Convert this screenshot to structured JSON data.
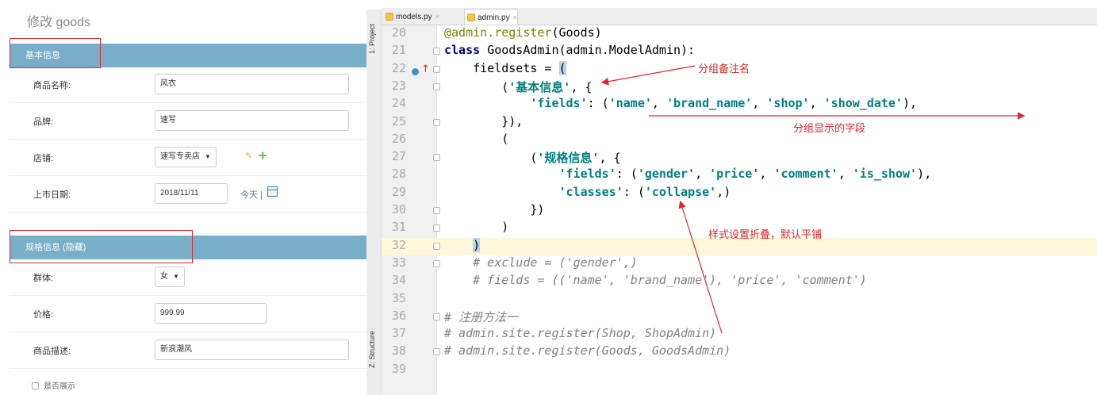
{
  "admin": {
    "page_title": "修改 goods",
    "fieldset1_title": "基本信息",
    "fieldset2_title": "规格信息 (隐藏)",
    "fields": {
      "name": {
        "label": "商品名称:",
        "value": "风衣"
      },
      "brand": {
        "label": "品牌:",
        "value": "速写"
      },
      "shop": {
        "label": "店铺:",
        "value": "速写专卖店"
      },
      "show_date": {
        "label": "上市日期:",
        "value": "2018/11/11",
        "today_label": "今天 |"
      },
      "gender": {
        "label": "群体:",
        "value": "女"
      },
      "price": {
        "label": "价格:",
        "value": "999.99"
      },
      "comment": {
        "label": "商品描述:",
        "value": "新浪潮风"
      },
      "is_show": {
        "label": "是否展示"
      }
    }
  },
  "ide": {
    "tabs": [
      {
        "label": "models.py",
        "active": false
      },
      {
        "label": "admin.py",
        "active": true
      }
    ],
    "side_labels": {
      "project": "1: Project",
      "structure": "Z: Structure"
    },
    "lines": [
      {
        "n": "20",
        "parts": [
          {
            "t": "@admin.register",
            "c": "dec"
          },
          {
            "t": "(Goods)",
            "c": ""
          }
        ]
      },
      {
        "n": "21",
        "parts": [
          {
            "t": "class ",
            "c": "kw"
          },
          {
            "t": "GoodsAdmin(admin.ModelAdmin):",
            "c": ""
          }
        ]
      },
      {
        "n": "22",
        "parts": [
          {
            "t": "    fieldsets = ",
            "c": ""
          },
          {
            "t": "(",
            "c": "bracket-hl"
          }
        ]
      },
      {
        "n": "23",
        "parts": [
          {
            "t": "        (",
            "c": ""
          },
          {
            "t": "'基本信息'",
            "c": "str"
          },
          {
            "t": ", {",
            "c": ""
          }
        ]
      },
      {
        "n": "24",
        "parts": [
          {
            "t": "            ",
            "c": ""
          },
          {
            "t": "'fields'",
            "c": "str"
          },
          {
            "t": ": (",
            "c": ""
          },
          {
            "t": "'name'",
            "c": "str"
          },
          {
            "t": ", ",
            "c": ""
          },
          {
            "t": "'brand_name'",
            "c": "str"
          },
          {
            "t": ", ",
            "c": ""
          },
          {
            "t": "'shop'",
            "c": "str"
          },
          {
            "t": ", ",
            "c": ""
          },
          {
            "t": "'show_date'",
            "c": "str"
          },
          {
            "t": "),",
            "c": ""
          }
        ]
      },
      {
        "n": "25",
        "parts": [
          {
            "t": "        }),",
            "c": ""
          }
        ]
      },
      {
        "n": "26",
        "parts": [
          {
            "t": "        (",
            "c": ""
          }
        ]
      },
      {
        "n": "27",
        "parts": [
          {
            "t": "            (",
            "c": ""
          },
          {
            "t": "'规格信息'",
            "c": "str"
          },
          {
            "t": ", {",
            "c": ""
          }
        ]
      },
      {
        "n": "28",
        "parts": [
          {
            "t": "                ",
            "c": ""
          },
          {
            "t": "'fields'",
            "c": "str"
          },
          {
            "t": ": (",
            "c": ""
          },
          {
            "t": "'gender'",
            "c": "str"
          },
          {
            "t": ", ",
            "c": ""
          },
          {
            "t": "'price'",
            "c": "str"
          },
          {
            "t": ", ",
            "c": ""
          },
          {
            "t": "'comment'",
            "c": "str"
          },
          {
            "t": ", ",
            "c": ""
          },
          {
            "t": "'is_show'",
            "c": "str"
          },
          {
            "t": "),",
            "c": ""
          }
        ]
      },
      {
        "n": "29",
        "parts": [
          {
            "t": "                ",
            "c": ""
          },
          {
            "t": "'classes'",
            "c": "str"
          },
          {
            "t": ": (",
            "c": ""
          },
          {
            "t": "'collapse'",
            "c": "str"
          },
          {
            "t": ",)",
            "c": ""
          }
        ]
      },
      {
        "n": "30",
        "parts": [
          {
            "t": "            })",
            "c": ""
          }
        ]
      },
      {
        "n": "31",
        "parts": [
          {
            "t": "        )",
            "c": ""
          }
        ]
      },
      {
        "n": "32",
        "parts": [
          {
            "t": "    ",
            "c": ""
          },
          {
            "t": ")",
            "c": "bracket-hl"
          }
        ]
      },
      {
        "n": "33",
        "parts": [
          {
            "t": "    # exclude = ('gender',)",
            "c": "com"
          }
        ]
      },
      {
        "n": "34",
        "parts": [
          {
            "t": "    # fields = (('name', 'brand_name'), 'price', 'comment')",
            "c": "com"
          }
        ]
      },
      {
        "n": "35",
        "parts": []
      },
      {
        "n": "36",
        "parts": [
          {
            "t": "# 注册方法一",
            "c": "com"
          }
        ]
      },
      {
        "n": "37",
        "parts": [
          {
            "t": "# admin.site.register(Shop, ShopAdmin)",
            "c": "com"
          }
        ]
      },
      {
        "n": "38",
        "parts": [
          {
            "t": "# admin.site.register(Goods, GoodsAdmin)",
            "c": "com"
          }
        ]
      },
      {
        "n": "39",
        "parts": []
      }
    ]
  },
  "annotations": {
    "group_name": "分组备注名",
    "group_fields": "分组显示的字段",
    "collapse_note": "样式设置折叠，默认平铺"
  },
  "colors": {
    "fieldset_bar": "#79aec8",
    "annotation_red": "#e0262a",
    "current_line": "#fdf8d9"
  }
}
